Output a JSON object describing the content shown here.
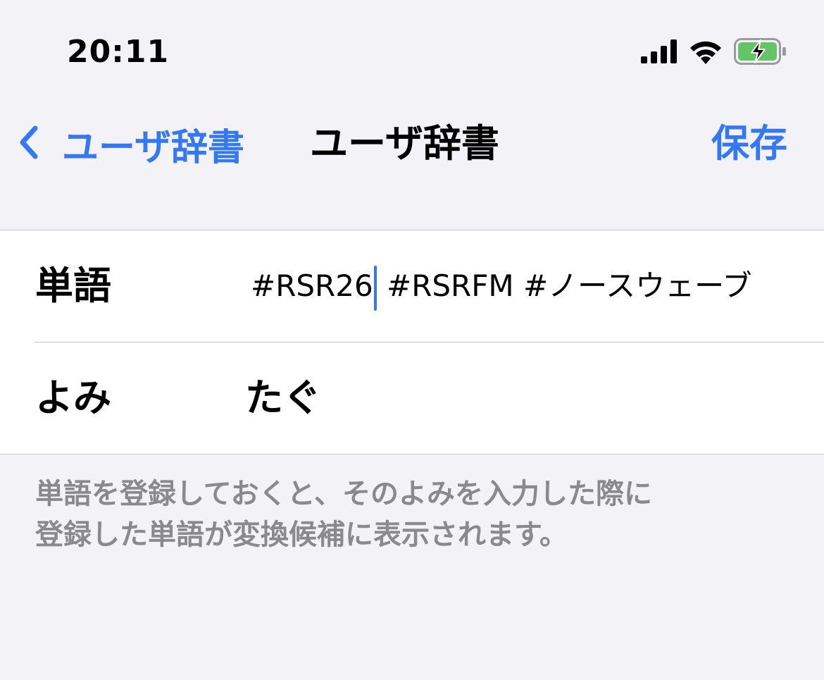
{
  "status_bar": {
    "time": "20:11",
    "icons": [
      "cellular-signal-icon",
      "wifi-icon",
      "battery-charging-icon"
    ]
  },
  "nav": {
    "back_label": "ユーザ辞書",
    "title": "ユーザ辞書",
    "save_label": "保存"
  },
  "form": {
    "word_label": "単語",
    "word_value_before_caret": "#RSR26",
    "word_value_after_caret": " #RSRFM #ノースウェーブ",
    "reading_label": "よみ",
    "reading_value": "たぐ"
  },
  "footer": {
    "line1": "単語を登録しておくと、そのよみを入力した際に",
    "line2": "登録した単語が変換候補に表示されます。"
  },
  "colors": {
    "accent": "#3478f6",
    "background": "#f2f2f7",
    "footer_text": "#8a8a8e",
    "battery_fill": "#65c466"
  }
}
